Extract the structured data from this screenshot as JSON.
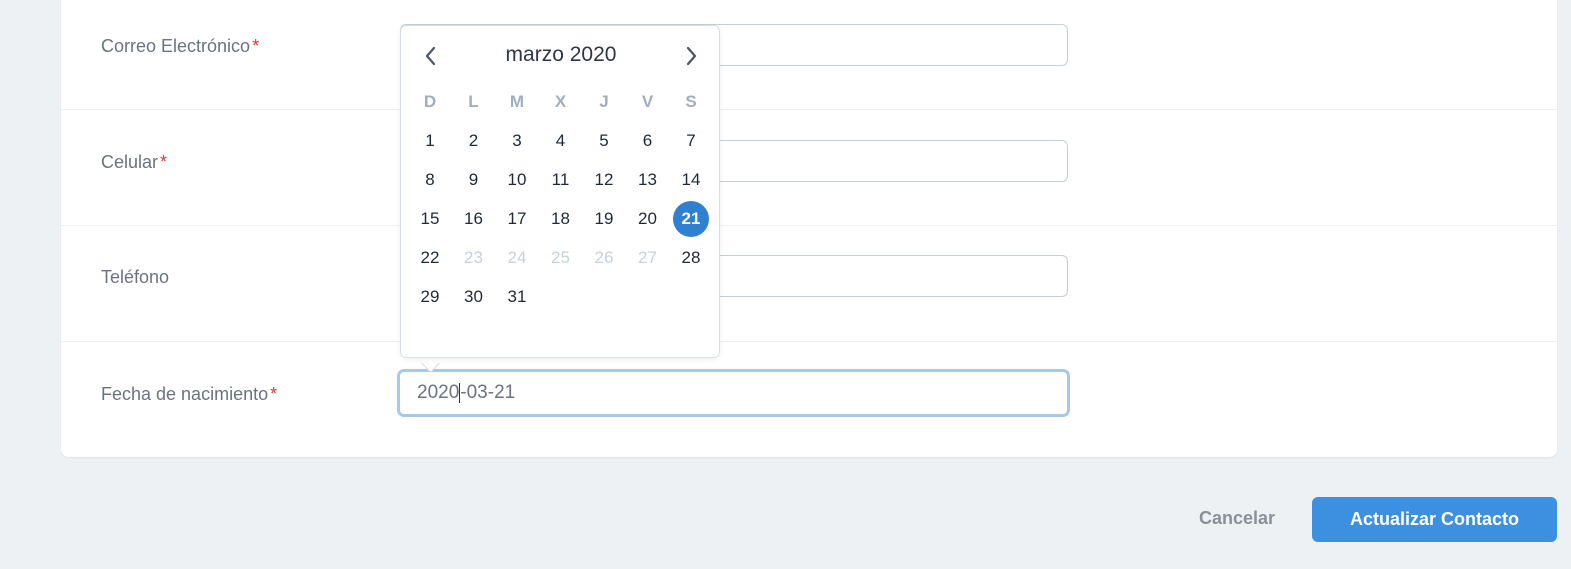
{
  "form": {
    "email": {
      "label": "Correo Electrónico",
      "required_mark": "*",
      "value": ""
    },
    "mobile": {
      "label": "Celular",
      "required_mark": "*",
      "value": ""
    },
    "phone": {
      "label": "Teléfono",
      "value": ""
    },
    "birthdate": {
      "label": "Fecha de nacimiento",
      "required_mark": "*",
      "value_part1": "2020",
      "value_part2": "-03-21"
    }
  },
  "datepicker": {
    "month_label": "marzo 2020",
    "prev_icon": "chevron-left-icon",
    "next_icon": "chevron-right-icon",
    "weekdays": [
      "D",
      "L",
      "M",
      "X",
      "J",
      "V",
      "S"
    ],
    "weeks": [
      [
        {
          "d": "1"
        },
        {
          "d": "2"
        },
        {
          "d": "3"
        },
        {
          "d": "4"
        },
        {
          "d": "5"
        },
        {
          "d": "6"
        },
        {
          "d": "7"
        }
      ],
      [
        {
          "d": "8"
        },
        {
          "d": "9"
        },
        {
          "d": "10"
        },
        {
          "d": "11"
        },
        {
          "d": "12"
        },
        {
          "d": "13"
        },
        {
          "d": "14"
        }
      ],
      [
        {
          "d": "15"
        },
        {
          "d": "16"
        },
        {
          "d": "17"
        },
        {
          "d": "18"
        },
        {
          "d": "19"
        },
        {
          "d": "20"
        },
        {
          "d": "21",
          "selected": true
        }
      ],
      [
        {
          "d": "22"
        },
        {
          "d": "23",
          "disabled": true
        },
        {
          "d": "24",
          "disabled": true
        },
        {
          "d": "25",
          "disabled": true
        },
        {
          "d": "26",
          "disabled": true
        },
        {
          "d": "27",
          "disabled": true
        },
        {
          "d": "28"
        }
      ],
      [
        {
          "d": "29"
        },
        {
          "d": "30"
        },
        {
          "d": "31"
        }
      ]
    ],
    "selected_color": "#2f80d1"
  },
  "actions": {
    "cancel_label": "Cancelar",
    "submit_label": "Actualizar Contacto",
    "submit_color": "#3d8fe0"
  }
}
